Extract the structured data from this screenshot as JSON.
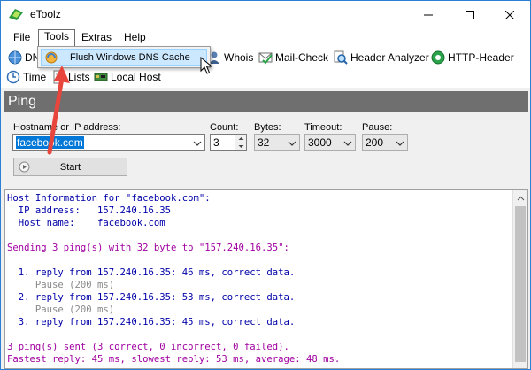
{
  "window": {
    "title": "eToolz"
  },
  "menu": {
    "file": "File",
    "tools": "Tools",
    "extras": "Extras",
    "help": "Help"
  },
  "dropdown": {
    "item": "Flush Windows DNS Cache"
  },
  "toolbar": {
    "row1": {
      "dns": "DN",
      "whois": "Whois",
      "mailcheck": "Mail-Check",
      "header_analyzer": "Header Analyzer",
      "http_header": "HTTP-Header"
    },
    "row2": {
      "time": "Time",
      "lists": "Lists",
      "localhost": "Local Host"
    }
  },
  "section": {
    "title": "Ping"
  },
  "form": {
    "hostname_label": "Hostname or IP address:",
    "hostname_value": "facebook.com",
    "count_label": "Count:",
    "count_value": "3",
    "bytes_label": "Bytes:",
    "bytes_value": "32",
    "timeout_label": "Timeout:",
    "timeout_value": "3000",
    "pause_label": "Pause:",
    "pause_value": "200",
    "start_label": "Start"
  },
  "output": {
    "lines": [
      {
        "text": "Host Information for \"facebook.com\":",
        "color": "blue"
      },
      {
        "text": "  IP address:   157.240.16.35",
        "color": "blue"
      },
      {
        "text": "  Host name:    facebook.com",
        "color": "blue"
      },
      {
        "text": "",
        "color": "blue"
      },
      {
        "text": "Sending 3 ping(s) with 32 byte to \"157.240.16.35\":",
        "color": "purple"
      },
      {
        "text": "",
        "color": "blue"
      },
      {
        "text": "  1. reply from 157.240.16.35: 46 ms, correct data.",
        "color": "blue"
      },
      {
        "text": "     Pause (200 ms)",
        "color": "grey"
      },
      {
        "text": "  2. reply from 157.240.16.35: 53 ms, correct data.",
        "color": "blue"
      },
      {
        "text": "     Pause (200 ms)",
        "color": "grey"
      },
      {
        "text": "  3. reply from 157.240.16.35: 45 ms, correct data.",
        "color": "blue"
      },
      {
        "text": "",
        "color": "blue"
      },
      {
        "text": "3 ping(s) sent (3 correct, 0 incorrect, 0 failed).",
        "color": "purple"
      },
      {
        "text": "Fastest reply: 45 ms, slowest reply: 53 ms, average: 48 ms.",
        "color": "purple"
      }
    ]
  },
  "colors": {
    "accent": "#0078d7",
    "annotation_arrow": "#e8453c",
    "header_bg": "#6f6f6f"
  }
}
